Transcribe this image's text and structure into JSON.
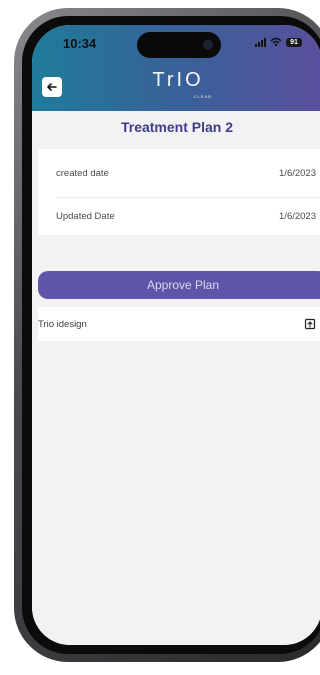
{
  "status_bar": {
    "time": "10:34",
    "battery": "91"
  },
  "header": {
    "logo_text": "TrIO",
    "logo_sub": "CLEAR"
  },
  "plan": {
    "title": "Treatment Plan 2",
    "created_label": "created date",
    "created_value": "1/6/2023",
    "updated_label": "Updated Date",
    "updated_value": "1/6/2023",
    "approve_label": "Approve Plan",
    "file_label": "Trio idesign"
  },
  "icons": {
    "back": "arrow-left-icon",
    "open": "open-icon"
  },
  "colors": {
    "header_start": "#1f7b9a",
    "header_end": "#5b4f9d",
    "title_color": "#3f3d86",
    "button_color": "#5d55a8"
  }
}
